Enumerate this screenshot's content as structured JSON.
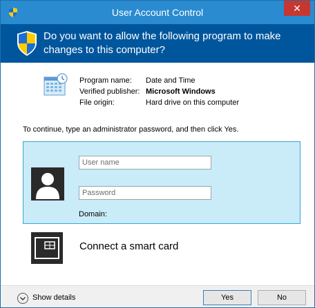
{
  "window": {
    "title": "User Account Control",
    "close_glyph": "✕",
    "title_icon": "uac-shield-icon"
  },
  "banner": {
    "question": "Do you want to allow the following program to make changes to this computer?",
    "icon": "uac-shield-icon"
  },
  "program": {
    "icon": "date-and-time-icon",
    "rows": [
      {
        "label": "Program name:",
        "value": "Date and Time"
      },
      {
        "label": "Verified publisher:",
        "value": "Microsoft Windows"
      },
      {
        "label": "File origin:",
        "value": "Hard drive on this computer"
      }
    ]
  },
  "instruction": "To continue, type an administrator password, and then click Yes.",
  "credentials": {
    "username_placeholder": "User name",
    "username_value": "",
    "password_placeholder": "Password",
    "password_value": "",
    "domain_label": "Domain:",
    "avatar_icon": "user-avatar-icon"
  },
  "smart_card": {
    "label": "Connect a smart card",
    "icon": "smart-card-icon"
  },
  "footer": {
    "show_details_label": "Show details",
    "details_icon": "chevron-down-circle-icon",
    "yes_label": "Yes",
    "no_label": "No"
  },
  "colors": {
    "titlebar": "#2a8bd0",
    "banner": "#00569d",
    "close_button": "#c7372f",
    "credential_box": "#c9ecf8",
    "credential_border": "#36a6d4"
  }
}
